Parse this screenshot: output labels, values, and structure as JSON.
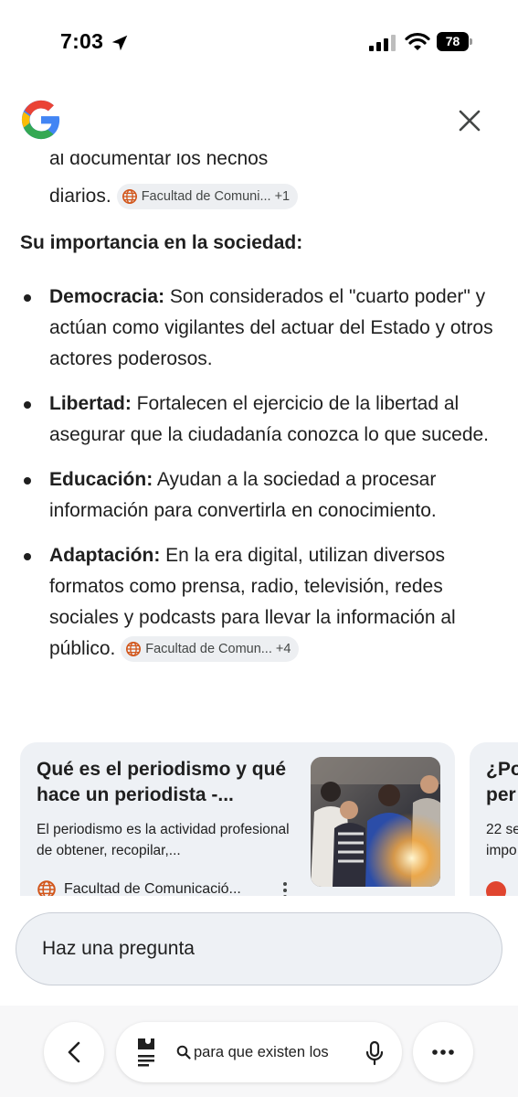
{
  "status_bar": {
    "time": "7:03",
    "battery": "78"
  },
  "answer": {
    "cut_line": "al documentar los hechos",
    "para_end": "diarios.",
    "chip_1": {
      "label": "Facultad de Comuni...",
      "count": "+1"
    },
    "section_title": "Su importancia en la sociedad:",
    "bullets": [
      {
        "term": "Democracia:",
        "text": " Son considerados el \"cuarto poder\" y actúan como vigilantes del actuar del Estado y otros actores poderosos."
      },
      {
        "term": "Libertad:",
        "text": " Fortalecen el ejercicio de la libertad al asegurar que la ciudadanía conozca lo que sucede."
      },
      {
        "term": "Educación:",
        "text": " Ayudan a la sociedad a procesar información para convertirla en conocimiento."
      },
      {
        "term": "Adaptación:",
        "text": " En la era digital, utilizan diversos formatos como prensa, radio, televisión, redes sociales y podcasts para llevar la información al público."
      }
    ],
    "chip_2": {
      "label": "Facultad de Comun...",
      "count": "+4"
    }
  },
  "cards": [
    {
      "title": "Qué es el periodismo y qué hace un periodista -...",
      "snippet": "El periodismo es la actividad profesional de obtener, recopilar,...",
      "source": "Facultad de Comunicació..."
    },
    {
      "title_line1": "¿Po",
      "title_line2": "per",
      "snippet_line1": "22 se",
      "snippet_line2": "impo"
    }
  ],
  "ask_bar": {
    "placeholder": "Haz una pregunta"
  },
  "bottom_nav": {
    "query": "para que existen los"
  },
  "colors": {
    "accent_blue": "#4285F4",
    "red": "#EA4335",
    "yellow": "#FBBC05",
    "green": "#34A853",
    "card_bg": "#eef1f5"
  }
}
